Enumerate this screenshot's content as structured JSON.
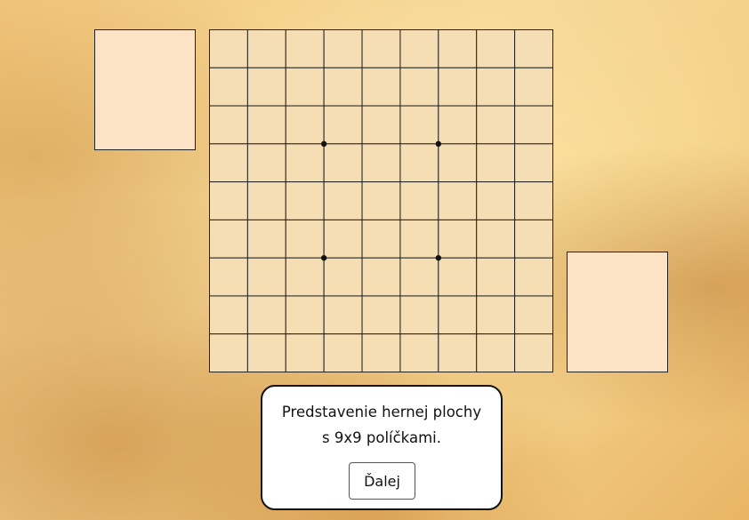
{
  "board": {
    "rows": 9,
    "cols": 9,
    "cell_color": "#f5deb3",
    "line_color": "#222222",
    "star_points": [
      [
        3,
        3
      ],
      [
        3,
        6
      ],
      [
        6,
        3
      ],
      [
        6,
        6
      ]
    ]
  },
  "bowls": {
    "color": "#fde3c5"
  },
  "dialog": {
    "message": "Predstavenie hernej plochy\ns 9x9 políčkami.",
    "next_label": "Ďalej"
  }
}
